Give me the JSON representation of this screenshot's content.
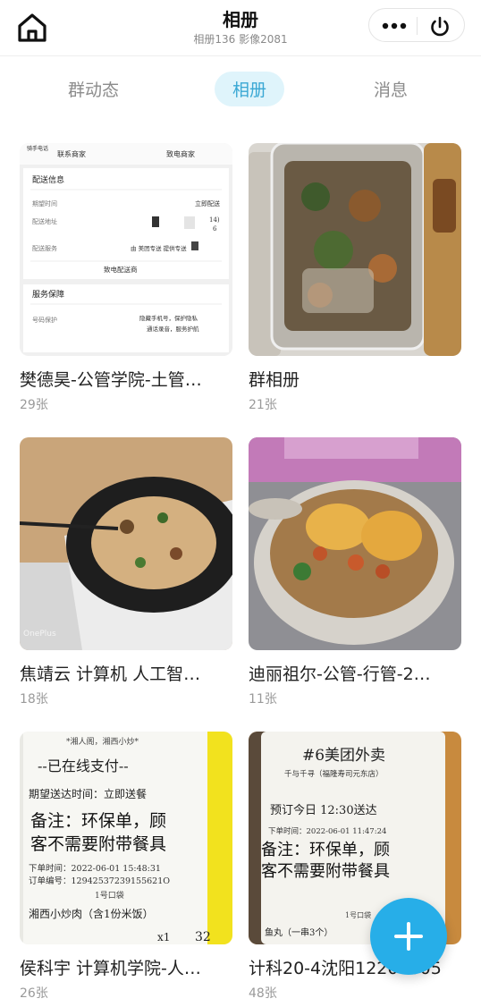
{
  "header": {
    "title": "相册",
    "subtitle": "相册136 影像2081",
    "home_icon": "home-icon",
    "more_icon": "more-dots-icon",
    "power_icon": "power-icon"
  },
  "tabs": [
    {
      "label": "群动态",
      "active": false
    },
    {
      "label": "相册",
      "active": true
    },
    {
      "label": "消息",
      "active": false
    }
  ],
  "albums": [
    {
      "name": "樊德昊-公管学院-土管…",
      "count": "29张"
    },
    {
      "name": "群相册",
      "count": "21张"
    },
    {
      "name": "焦靖云 计算机 人工智…",
      "count": "18张"
    },
    {
      "name": "迪丽祖尔-公管-行管-2…",
      "count": "11张"
    },
    {
      "name": "侯科宇 计算机学院-人…",
      "count": "26张"
    },
    {
      "name": "计科20-4沈阳12200005",
      "count": "48张"
    }
  ],
  "thumb_text": {
    "album0": {
      "top_left": "骑手电话",
      "contact_merchant": "联系商家",
      "call_merchant": "致电商家",
      "section_delivery": "配送信息",
      "expected_time_label": "期望时间",
      "expected_time_value": "立即配送",
      "address_label": "配送地址",
      "address_value_1": "14)",
      "address_value_2": "6",
      "service_label": "配送服务",
      "service_value": "由 美团专送 提供专送",
      "call_delivery": "致电配送商",
      "section_guarantee": "服务保障",
      "privacy_label": "号码保护",
      "privacy_value_1": "隐藏手机号，保护隐私",
      "privacy_value_2": "通话录音，服务护航"
    },
    "album2": {
      "watermark": "OnePlus"
    },
    "album4": {
      "line1": "*湘人阁，湘西小炒*",
      "line2": "--已在线支付--",
      "line3": "期望送达时间：立即送餐",
      "line4": "备注：环保单，顾",
      "line5": "客不需要附带餐具",
      "line6": "下单时间：2022-06-01 15:48:31",
      "line7": "订单编号：12942537239155621O",
      "line8": "1号口袋",
      "line9": "湘西小炒肉（含1份米饭）",
      "qty": "x1",
      "price": "32"
    },
    "album5": {
      "line1": "#6美团外卖",
      "line2": "千与千寻（福隆寿司元东店）",
      "line3": "预订今日 12:30送达",
      "line4": "下单时间：2022-06-01 11:47:24",
      "line5": "备注：环保单，顾",
      "line6": "客不需要附带餐具",
      "line7": "1号口袋",
      "line8": "鱼丸（一串3个）"
    }
  },
  "fab": {
    "icon": "plus-icon",
    "color": "#27aee8"
  },
  "colors": {
    "accent": "#3aa8d4",
    "tab_active_bg": "#dff4fb"
  }
}
